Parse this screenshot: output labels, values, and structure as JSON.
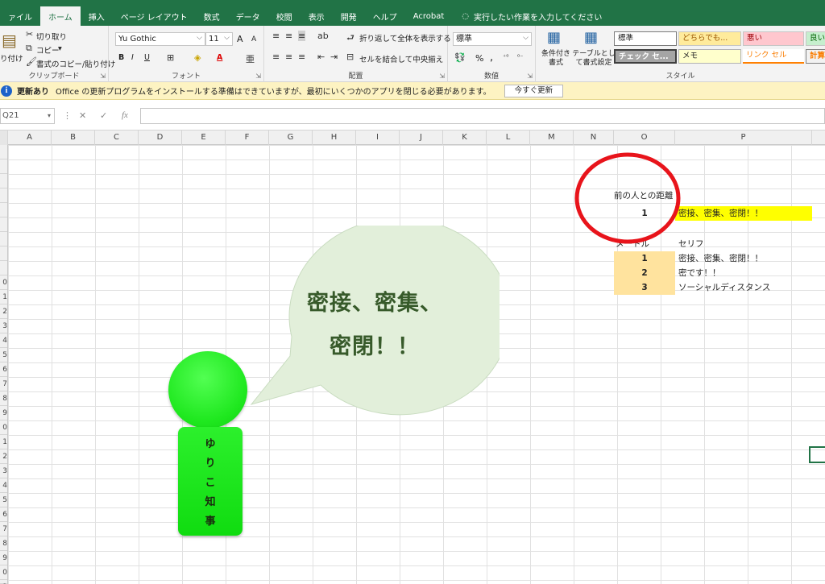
{
  "menu": {
    "tabs": [
      "ァイル",
      "ホーム",
      "挿入",
      "ページ レイアウト",
      "数式",
      "データ",
      "校閲",
      "表示",
      "開発",
      "ヘルプ",
      "Acrobat"
    ],
    "active_index": 1,
    "search_placeholder": "実行したい作業を入力してください"
  },
  "ribbon": {
    "clipboard": {
      "label": "クリップボード",
      "paste": "り付け",
      "cut": "切り取り",
      "copy": "コピー",
      "format_painter": "書式のコピー/貼り付け"
    },
    "font": {
      "label": "フォント",
      "name": "Yu Gothic",
      "size": "11",
      "bold": "B",
      "italic": "I",
      "underline": "U",
      "grow": "A",
      "shrink": "A",
      "color_letter": "A"
    },
    "alignment": {
      "label": "配置",
      "wrap": "折り返して全体を表示する",
      "merge": "セルを結合して中央揃え"
    },
    "number": {
      "label": "数値",
      "format": "標準",
      "percent": "%",
      "comma": ","
    },
    "styles_group": {
      "label": "スタイル",
      "conditional": "条件付き書式",
      "table": "テーブルとして書式設定",
      "cells": [
        "標準",
        "どちらでも...",
        "悪い",
        "良い",
        "チェック セ...",
        "メモ",
        "リンク セル",
        "計算"
      ]
    }
  },
  "notification": {
    "title": "更新あり",
    "message": "Office の更新プログラムをインストールする準備はできていますが、最初にいくつかのアプリを閉じる必要があります。",
    "button": "今すぐ更新"
  },
  "formula_bar": {
    "name_box": "Q21",
    "cancel": "✕",
    "enter": "✓",
    "fx": "fx",
    "value": ""
  },
  "grid": {
    "columns": [
      "A",
      "B",
      "C",
      "D",
      "E",
      "F",
      "G",
      "H",
      "I",
      "J",
      "K",
      "L",
      "M",
      "N",
      "O",
      "P"
    ],
    "rows": [
      "",
      "",
      "",
      "",
      "",
      "",
      "",
      "",
      "",
      "0",
      "1",
      "2",
      "3",
      "4",
      "5",
      "6",
      "7",
      "8",
      "9",
      "0",
      "1",
      "2",
      "3",
      "4",
      "5",
      "6",
      "7",
      "8",
      "9",
      "0",
      "1"
    ]
  },
  "cells": {
    "o_distance_label": "前の人との距離",
    "o_distance_value": "1",
    "p_distance_phrase": "密接、密集、密閉！！",
    "o_meter_header": "メートル",
    "p_serif_header": "セリフ",
    "table": [
      {
        "meters": "1",
        "serif": "密接、密集、密閉！！"
      },
      {
        "meters": "2",
        "serif": "密です！！"
      },
      {
        "meters": "3",
        "serif": "ソーシャルディスタンス"
      }
    ]
  },
  "shapes": {
    "bubble_line1": "密接、密集、",
    "bubble_line2": "密閉！！",
    "person_name_chars": [
      "ゆ",
      "り",
      "こ",
      "知",
      "事"
    ]
  },
  "colors": {
    "excel_green": "#217346",
    "yellow_fill": "#ffff00",
    "table_fill": "#ffe39e",
    "figure_green": "#1fe81f",
    "bubble_fill": "#e2efda",
    "red_circle": "#e8141b"
  }
}
